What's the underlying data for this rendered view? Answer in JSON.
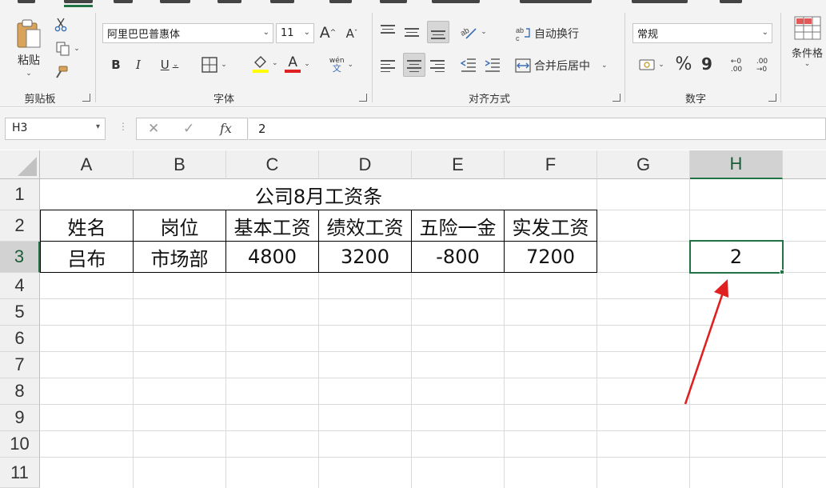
{
  "ribbon": {
    "clipboard": {
      "label": "剪贴板",
      "paste_label": "粘贴"
    },
    "font": {
      "label": "字体",
      "name": "阿里巴巴普惠体",
      "size": "11",
      "bold": "B",
      "italic": "I",
      "underline": "U",
      "font_color_glyph": "A",
      "phonetic_top": "wén",
      "phonetic_bottom": "文",
      "grow": "A",
      "shrink": "A"
    },
    "alignment": {
      "label": "对齐方式",
      "wrap_label": "自动换行",
      "merge_label": "合并后居中"
    },
    "number": {
      "label": "数字",
      "format": "常规",
      "percent": "%",
      "comma": "9",
      "inc_decimal_top": "←0",
      "inc_decimal_bottom": ".00",
      "dec_decimal_top": ".00",
      "dec_decimal_bottom": "→0"
    },
    "styles": {
      "cond_format_label": "条件格"
    },
    "colors": {
      "accent": "#217346",
      "fill_yellow": "#ffff00",
      "font_red": "#e02020"
    }
  },
  "formula_bar": {
    "name_box": "H3",
    "cancel": "✕",
    "enter": "✓",
    "fx": "fx",
    "value": "2"
  },
  "sheet": {
    "columns": [
      "A",
      "B",
      "C",
      "D",
      "E",
      "F",
      "G",
      "H"
    ],
    "rows": [
      "1",
      "2",
      "3",
      "4",
      "5",
      "6",
      "7",
      "8",
      "9",
      "10",
      "11"
    ],
    "selected_cell": "H3",
    "title": "公司8月工资条",
    "headers": [
      "姓名",
      "岗位",
      "基本工资",
      "绩效工资",
      "五险一金",
      "实发工资"
    ],
    "record": [
      "吕布",
      "市场部",
      "4800",
      "3200",
      "-800",
      "7200"
    ],
    "h3_value": "2"
  },
  "annotation": {
    "arrow_color": "#e02020"
  }
}
